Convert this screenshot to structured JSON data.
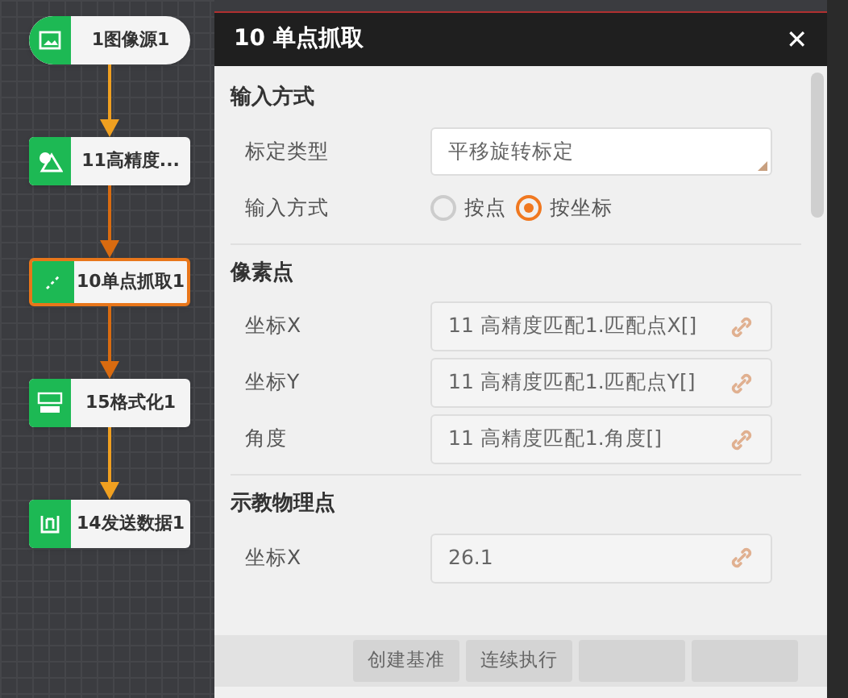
{
  "flow_nodes": [
    {
      "label": "1图像源1",
      "kind": "source",
      "selected": false
    },
    {
      "label": "11高精度...",
      "kind": "match",
      "selected": false
    },
    {
      "label": "10单点抓取1",
      "kind": "point",
      "selected": true
    },
    {
      "label": "15格式化1",
      "kind": "format",
      "selected": false
    },
    {
      "label": "14发送数据1",
      "kind": "send",
      "selected": false
    }
  ],
  "connectors": [
    {
      "color": "#f0a020"
    },
    {
      "color": "#d96b10"
    },
    {
      "color": "#d96b10"
    },
    {
      "color": "#f0a020"
    }
  ],
  "dialog": {
    "title": "10 单点抓取",
    "close": "✕",
    "sections": [
      {
        "title": "输入方式",
        "rows": [
          {
            "kind": "select",
            "label": "标定类型",
            "value": "平移旋转标定"
          },
          {
            "kind": "radio",
            "label": "输入方式",
            "options": [
              {
                "label": "按点",
                "selected": false
              },
              {
                "label": "按坐标",
                "selected": true
              }
            ]
          }
        ]
      },
      {
        "title": "像素点",
        "rows": [
          {
            "kind": "link",
            "label": "坐标X",
            "value": "11 高精度匹配1.匹配点X[]"
          },
          {
            "kind": "link",
            "label": "坐标Y",
            "value": "11 高精度匹配1.匹配点Y[]"
          },
          {
            "kind": "link",
            "label": "角度",
            "value": "11 高精度匹配1.角度[]"
          }
        ]
      },
      {
        "title": "示教物理点",
        "rows": [
          {
            "kind": "link",
            "label": "坐标X",
            "value": "26.1"
          }
        ]
      }
    ],
    "buttons": [
      "创建基准",
      "连续执行"
    ]
  }
}
